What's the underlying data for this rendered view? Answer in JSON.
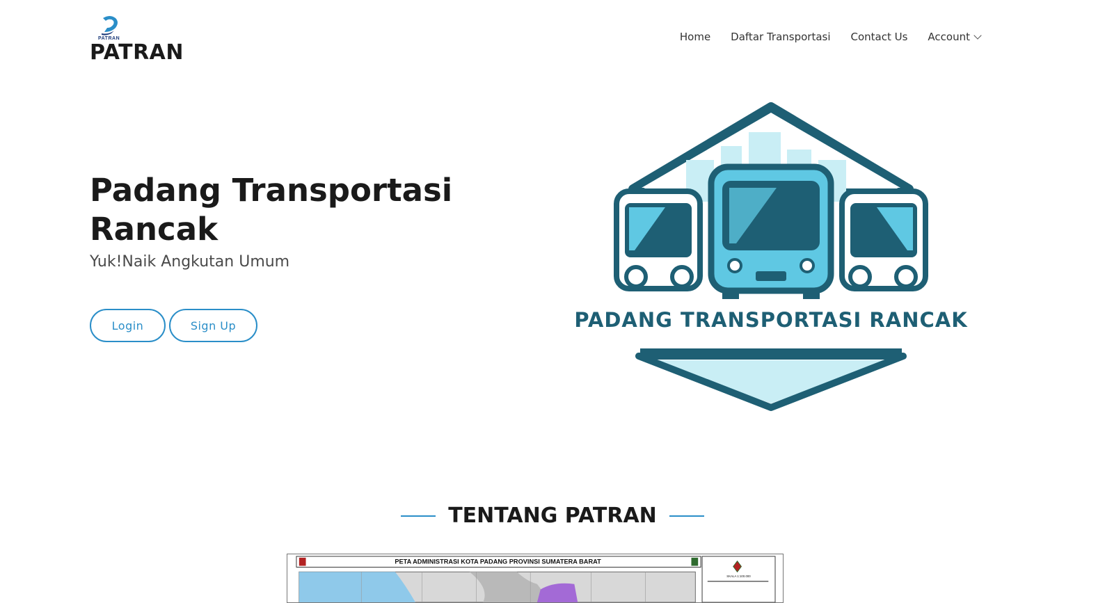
{
  "brand": {
    "logo_small": "PATRAN",
    "logo_text": "PATRAN",
    "colors": {
      "accent": "#2a8ec8",
      "dark_teal": "#1e5f74",
      "light_blue": "#5fc8e3",
      "pale_blue": "#c9eef5"
    }
  },
  "nav": {
    "items": [
      {
        "label": "Home"
      },
      {
        "label": "Daftar Transportasi"
      },
      {
        "label": "Contact Us"
      },
      {
        "label": "Account"
      }
    ]
  },
  "hero": {
    "title": "Padang Transportasi Rancak",
    "subtitle": "Yuk!Naik Angkutan Umum",
    "login_label": "Login",
    "signup_label": "Sign Up",
    "art_caption": "PADANG TRANSPORTASI RANCAK"
  },
  "about": {
    "title": "TENTANG PATRAN",
    "map_title": "PETA ADMINISTRASI KOTA PADANG PROVINSI SUMATERA BARAT",
    "map_scale": "SKALA 1:100.000"
  }
}
